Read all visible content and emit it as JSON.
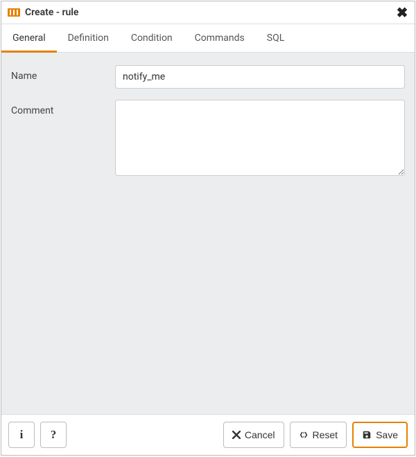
{
  "title": "Create - rule",
  "tabs": [
    {
      "label": "General",
      "active": true
    },
    {
      "label": "Definition",
      "active": false
    },
    {
      "label": "Condition",
      "active": false
    },
    {
      "label": "Commands",
      "active": false
    },
    {
      "label": "SQL",
      "active": false
    }
  ],
  "form": {
    "name_label": "Name",
    "name_value": "notify_me",
    "comment_label": "Comment",
    "comment_value": ""
  },
  "footer": {
    "info_label": "i",
    "help_label": "?",
    "cancel_label": "Cancel",
    "reset_label": "Reset",
    "save_label": "Save"
  },
  "colors": {
    "accent": "#e58000"
  }
}
